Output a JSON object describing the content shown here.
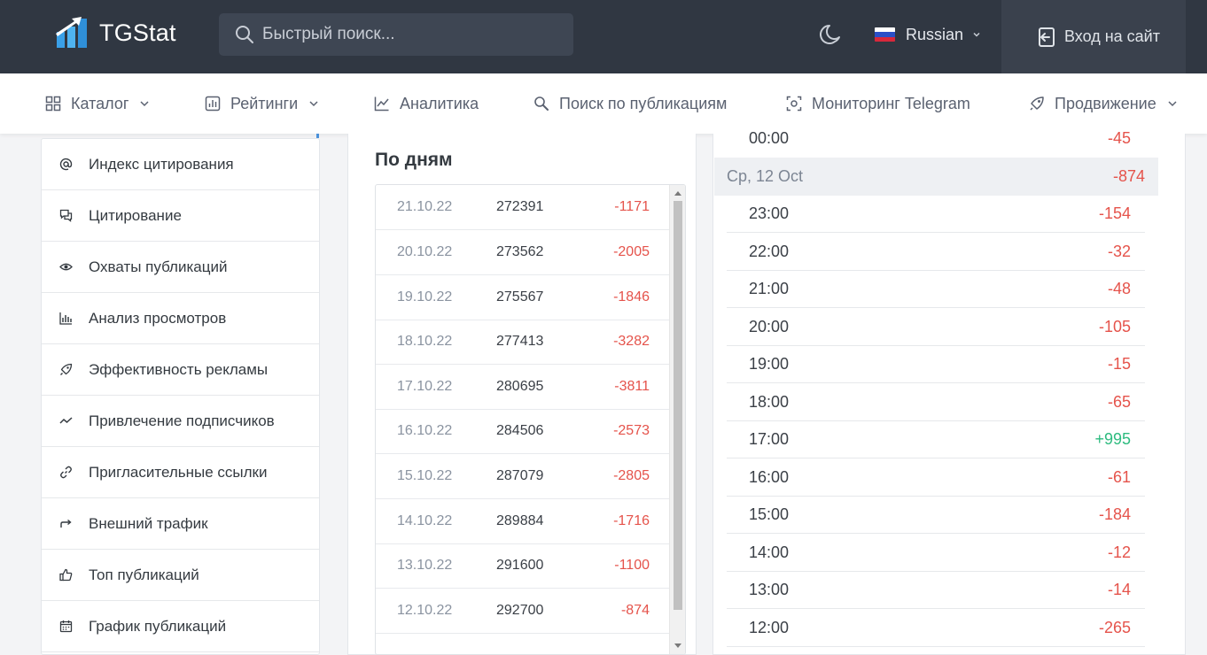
{
  "header": {
    "logo_text": "TGStat",
    "search_placeholder": "Быстрый поиск...",
    "language": "Russian",
    "login_label": "Вход на сайт"
  },
  "nav": {
    "items": [
      {
        "label": "Каталог",
        "icon": "grid-icon",
        "has_dropdown": true
      },
      {
        "label": "Рейтинги",
        "icon": "bar-chart-icon",
        "has_dropdown": true
      },
      {
        "label": "Аналитика",
        "icon": "line-chart-icon",
        "has_dropdown": false
      },
      {
        "label": "Поиск по публикациям",
        "icon": "search-icon",
        "has_dropdown": false
      },
      {
        "label": "Мониторинг Telegram",
        "icon": "scan-icon",
        "has_dropdown": false
      },
      {
        "label": "Продвижение",
        "icon": "rocket-icon",
        "has_dropdown": true
      }
    ]
  },
  "sidebar": {
    "items": [
      {
        "label": "Индекс цитирования",
        "icon": "at-icon"
      },
      {
        "label": "Цитирование",
        "icon": "comments-icon"
      },
      {
        "label": "Охваты публикаций",
        "icon": "eye-icon"
      },
      {
        "label": "Анализ просмотров",
        "icon": "bar-chart-icon"
      },
      {
        "label": "Эффективность рекламы",
        "icon": "rocket-icon"
      },
      {
        "label": "Привлечение подписчиков",
        "icon": "trend-icon"
      },
      {
        "label": "Пригласительные ссылки",
        "icon": "link-icon"
      },
      {
        "label": "Внешний трафик",
        "icon": "share-arrow-icon"
      },
      {
        "label": "Топ публикаций",
        "icon": "thumbs-up-icon"
      },
      {
        "label": "График публикаций",
        "icon": "calendar-icon"
      }
    ]
  },
  "daily": {
    "title": "По дням",
    "rows": [
      {
        "date": "21.10.22",
        "value": "272391",
        "diff": "-1171"
      },
      {
        "date": "20.10.22",
        "value": "273562",
        "diff": "-2005"
      },
      {
        "date": "19.10.22",
        "value": "275567",
        "diff": "-1846"
      },
      {
        "date": "18.10.22",
        "value": "277413",
        "diff": "-3282"
      },
      {
        "date": "17.10.22",
        "value": "280695",
        "diff": "-3811"
      },
      {
        "date": "16.10.22",
        "value": "284506",
        "diff": "-2573"
      },
      {
        "date": "15.10.22",
        "value": "287079",
        "diff": "-2805"
      },
      {
        "date": "14.10.22",
        "value": "289884",
        "diff": "-1716"
      },
      {
        "date": "13.10.22",
        "value": "291600",
        "diff": "-1100"
      },
      {
        "date": "12.10.22",
        "value": "292700",
        "diff": "-874"
      }
    ]
  },
  "hourly": {
    "top_row": {
      "time": "00:00",
      "value": "-45"
    },
    "day_header": {
      "label": "Ср, 12 Oct",
      "value": "-874"
    },
    "rows": [
      {
        "time": "23:00",
        "value": "-154"
      },
      {
        "time": "22:00",
        "value": "-32"
      },
      {
        "time": "21:00",
        "value": "-48"
      },
      {
        "time": "20:00",
        "value": "-105"
      },
      {
        "time": "19:00",
        "value": "-15"
      },
      {
        "time": "18:00",
        "value": "-65"
      },
      {
        "time": "17:00",
        "value": "+995"
      },
      {
        "time": "16:00",
        "value": "-61"
      },
      {
        "time": "15:00",
        "value": "-184"
      },
      {
        "time": "14:00",
        "value": "-12"
      },
      {
        "time": "13:00",
        "value": "-14"
      },
      {
        "time": "12:00",
        "value": "-265"
      }
    ]
  },
  "colors": {
    "negative": "#e5534b",
    "positive": "#2dbb7f",
    "topbar": "#303742",
    "accent": "#4a90d9"
  }
}
